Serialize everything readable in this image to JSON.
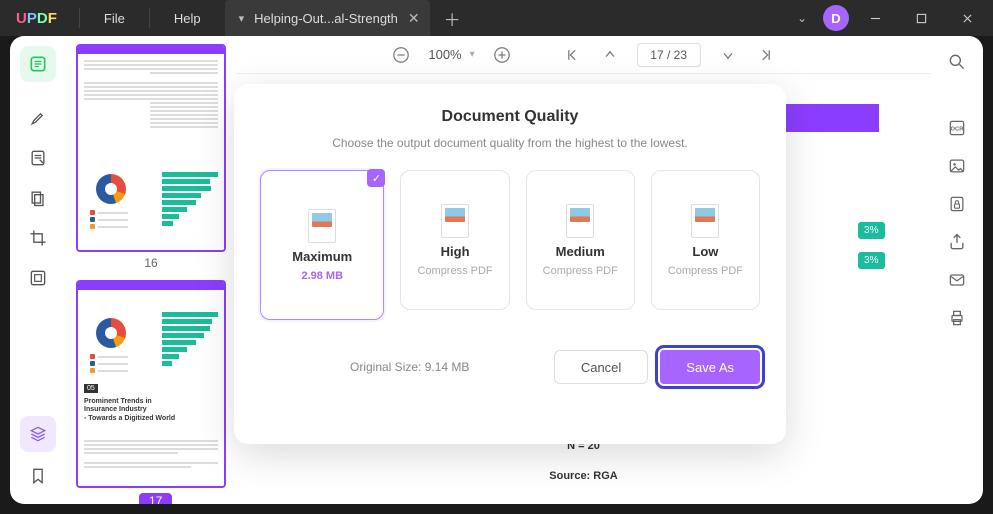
{
  "titlebar": {
    "menus": [
      "File",
      "Help"
    ],
    "tab_title": "Helping-Out...al-Strength",
    "avatar_letter": "D"
  },
  "toolbar": {
    "zoom": "100%",
    "page_cur": "17",
    "page_sep": "/",
    "page_total": "23"
  },
  "thumbs": {
    "p16": {
      "label": "16",
      "headline": "Prominent Trends in\nInsurance Industry\n- Towards a Digitized World",
      "blk": "05"
    },
    "p17": {
      "label": "17"
    }
  },
  "page": {
    "n20": "N = 20",
    "source": "Source: RGA",
    "r1": "3%",
    "r2": "3%"
  },
  "modal": {
    "title": "Document Quality",
    "subtitle": "Choose the output document quality from the highest to the lowest.",
    "opts": [
      {
        "name": "Maximum",
        "sub": "2.98 MB"
      },
      {
        "name": "High",
        "sub": "Compress PDF"
      },
      {
        "name": "Medium",
        "sub": "Compress PDF"
      },
      {
        "name": "Low",
        "sub": "Compress PDF"
      }
    ],
    "orig": "Original Size: 9.14 MB",
    "cancel": "Cancel",
    "save": "Save As"
  }
}
